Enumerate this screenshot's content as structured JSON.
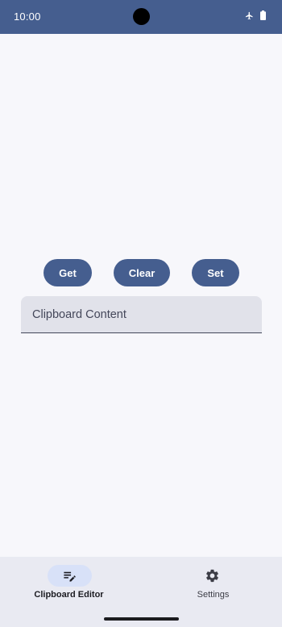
{
  "status_bar": {
    "time": "10:00",
    "background": "#455e8f",
    "icons": [
      "airplane-mode-icon",
      "battery-icon"
    ]
  },
  "actions": {
    "get_label": "Get",
    "clear_label": "Clear",
    "set_label": "Set",
    "accent": "#455e8f"
  },
  "clipboard_field": {
    "placeholder": "Clipboard Content",
    "value": ""
  },
  "bottom_nav": {
    "items": [
      {
        "label": "Clipboard Editor",
        "icon": "edit-note-icon",
        "selected": true
      },
      {
        "label": "Settings",
        "icon": "gear-icon",
        "selected": false
      }
    ]
  }
}
